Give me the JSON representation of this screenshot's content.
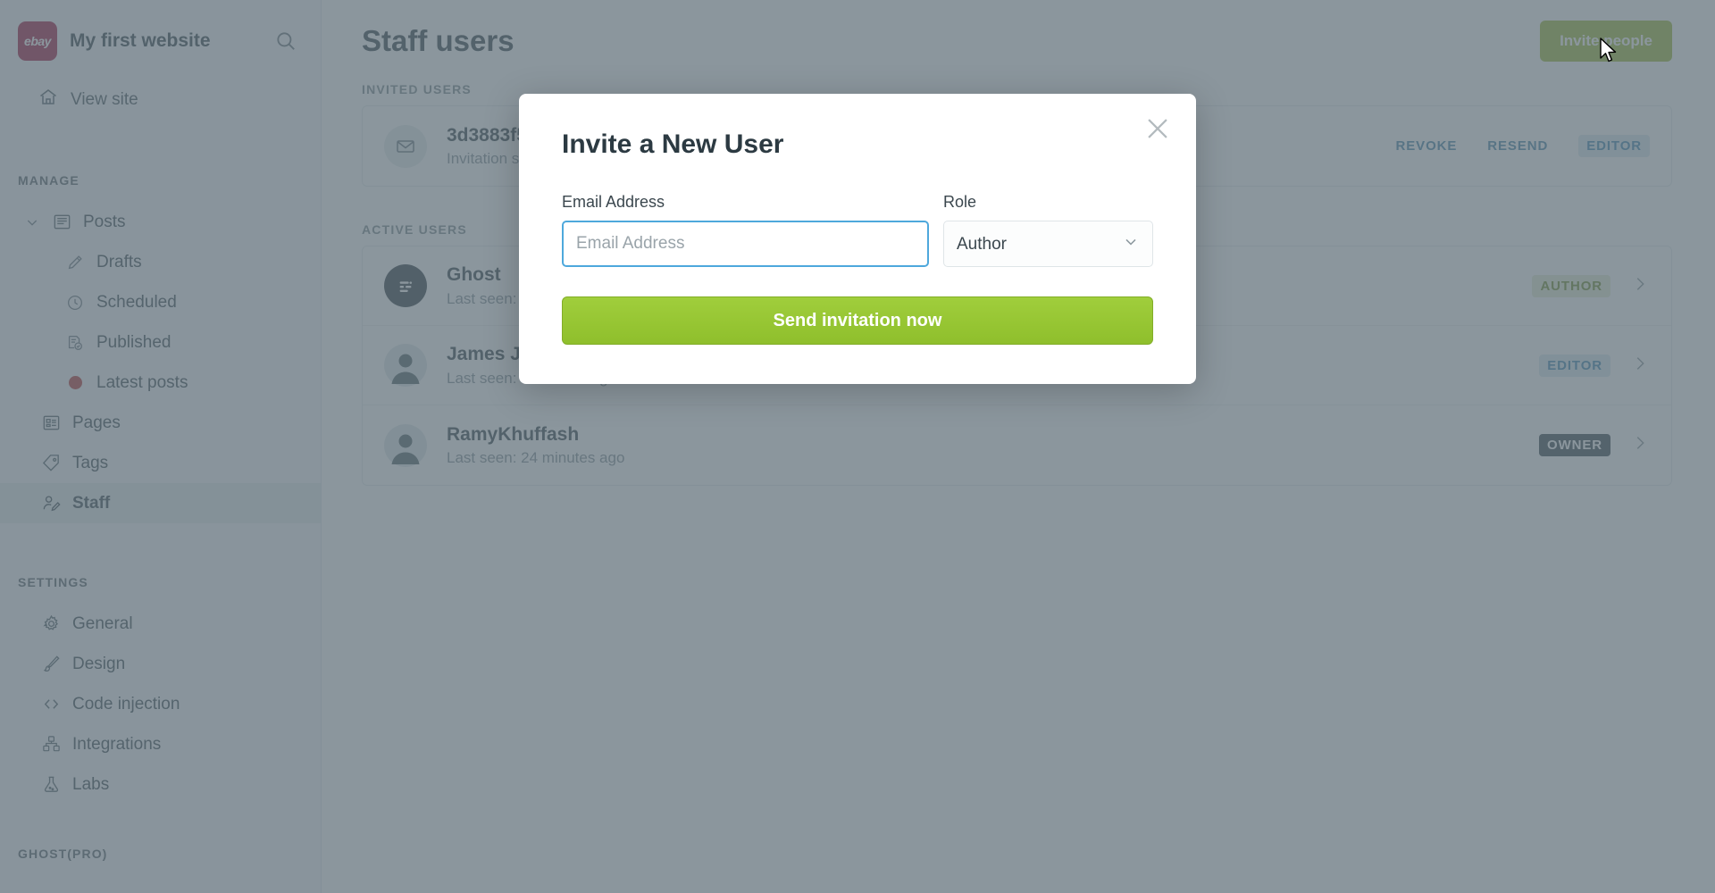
{
  "sidebar": {
    "logo_text": "ebay",
    "site_title": "My first website",
    "search_icon": "search-icon",
    "view_site": "View site",
    "manage_label": "MANAGE",
    "settings_label": "SETTINGS",
    "footer_label": "GHOST(PRO)",
    "manage_items": [
      {
        "label": "Posts",
        "icon": "posts-icon",
        "indent": false,
        "active": false,
        "expandable": true
      },
      {
        "label": "Drafts",
        "icon": "pencil-icon",
        "indent": true,
        "active": false
      },
      {
        "label": "Scheduled",
        "icon": "clock-icon",
        "indent": true,
        "active": false
      },
      {
        "label": "Published",
        "icon": "published-check-icon",
        "indent": true,
        "active": false
      },
      {
        "label": "Latest posts",
        "icon": "red-dot-icon",
        "indent": true,
        "active": false
      },
      {
        "label": "Pages",
        "icon": "pages-icon",
        "indent": false,
        "active": false
      },
      {
        "label": "Tags",
        "icon": "tag-icon",
        "indent": false,
        "active": false
      },
      {
        "label": "Staff",
        "icon": "staff-icon",
        "indent": false,
        "active": true
      }
    ],
    "settings_items": [
      {
        "label": "General",
        "icon": "gear-icon",
        "indent": true
      },
      {
        "label": "Design",
        "icon": "brush-icon",
        "indent": true
      },
      {
        "label": "Code injection",
        "icon": "code-icon",
        "indent": true
      },
      {
        "label": "Integrations",
        "icon": "integrations-icon",
        "indent": true
      },
      {
        "label": "Labs",
        "icon": "flask-icon",
        "indent": true
      }
    ]
  },
  "main": {
    "page_title": "Staff users",
    "invite_button": "Invite people",
    "invited_label": "INVITED USERS",
    "active_label": "ACTIVE USERS",
    "invited_users": [
      {
        "name": "3d3883f5",
        "status": "Invitation sent",
        "revoke": "REVOKE",
        "resend": "RESEND",
        "role": "EDITOR",
        "role_class": "editor",
        "avatar": "mail-icon"
      }
    ],
    "active_users": [
      {
        "name": "Ghost",
        "last_seen": "Last seen:",
        "role": "AUTHOR",
        "role_class": "author",
        "avatar": "ghost-logo-icon"
      },
      {
        "name": "James Jonas",
        "last_seen": "Last seen: 4 minutes ago",
        "role": "EDITOR",
        "role_class": "editor",
        "avatar": "person-icon"
      },
      {
        "name": "RamyKhuffash",
        "last_seen": "Last seen: 24 minutes ago",
        "role": "OWNER",
        "role_class": "owner",
        "avatar": "person-icon"
      }
    ]
  },
  "modal": {
    "title": "Invite a New User",
    "close_icon": "close-icon",
    "email_label": "Email Address",
    "email_value": "",
    "email_placeholder": "Email Address",
    "role_label": "Role",
    "role_value": "Author",
    "role_options": [
      "Author"
    ],
    "submit_label": "Send invitation now"
  },
  "colors": {
    "brand_red": "#a31b42",
    "accent_green": "#9fbb3a",
    "submit_green": "#97c433",
    "focus_blue": "#4ea8dc",
    "owner_badge": "#3b4950"
  }
}
